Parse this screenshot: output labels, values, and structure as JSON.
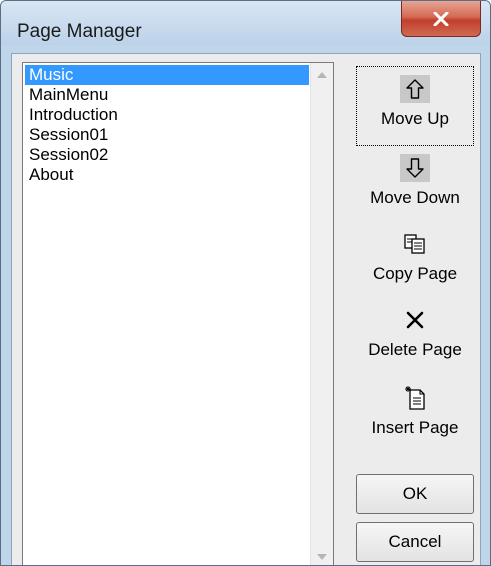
{
  "window": {
    "title": "Page Manager"
  },
  "pages": {
    "items": [
      "Music",
      "MainMenu",
      "Introduction",
      "Session01",
      "Session02",
      "About"
    ],
    "selected": "Music"
  },
  "buttons": {
    "move_up": "Move Up",
    "move_down": "Move Down",
    "copy_page": "Copy Page",
    "delete_page": "Delete Page",
    "insert_page": "Insert Page",
    "ok": "OK",
    "cancel": "Cancel"
  },
  "colors": {
    "selection": "#3399ff",
    "close_button": "#c1402c"
  },
  "icons": {
    "close": "close-x-icon",
    "move_up": "arrow-up-icon",
    "move_down": "arrow-down-icon",
    "copy": "copy-icon",
    "delete": "x-icon",
    "insert": "insert-page-icon"
  }
}
